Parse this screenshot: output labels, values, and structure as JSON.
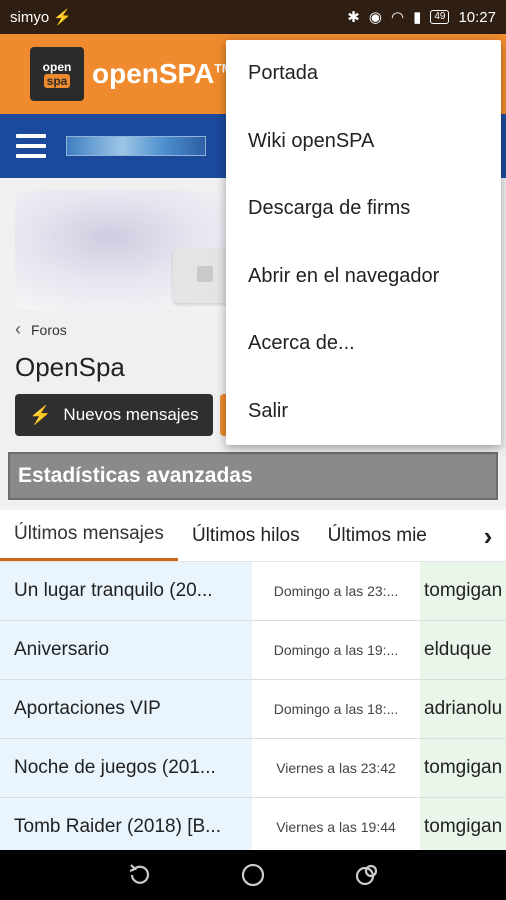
{
  "status": {
    "carrier": "simyo",
    "battery": "49",
    "time": "10:27"
  },
  "app": {
    "brand": "openSPA",
    "trademark": "TM",
    "logo_top": "open",
    "logo_bottom": "spa"
  },
  "breadcrumb": {
    "label": "Foros"
  },
  "page": {
    "title": "OpenSpa",
    "new_posts_label": "Nuevos mensajes"
  },
  "stats": {
    "header": "Estadísticas avanzadas"
  },
  "tabs": [
    {
      "label": "Últimos mensajes"
    },
    {
      "label": "Últimos hilos"
    },
    {
      "label": "Últimos miembros"
    }
  ],
  "rows": [
    {
      "title": "Un lugar tranquilo (20...",
      "date": "Domingo a las 23:...",
      "user": "tomgigan"
    },
    {
      "title": "Aniversario",
      "date": "Domingo a las 19:...",
      "user": "elduque"
    },
    {
      "title": "Aportaciones VIP",
      "date": "Domingo a las 18:...",
      "user": "adrianolu"
    },
    {
      "title": "Noche de juegos (201...",
      "date": "Viernes a las 23:42",
      "user": "tomgigan"
    },
    {
      "title": "Tomb Raider (2018) [B...",
      "date": "Viernes a las 19:44",
      "user": "tomgigan"
    }
  ],
  "menu": {
    "items": [
      {
        "label": "Portada"
      },
      {
        "label": "Wiki openSPA"
      },
      {
        "label": "Descarga de firms"
      },
      {
        "label": "Abrir en el navegador"
      },
      {
        "label": "Acerca de..."
      },
      {
        "label": "Salir"
      }
    ]
  },
  "colors": {
    "appbar": "#ef8b2e",
    "navbar": "#1b4a9c",
    "statusbar": "#2e1f12"
  }
}
